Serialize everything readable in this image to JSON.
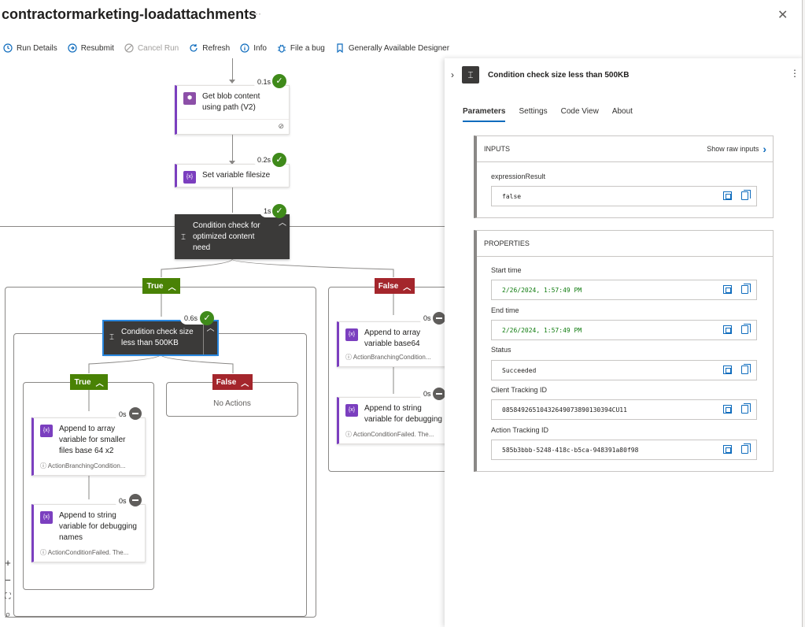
{
  "header": {
    "title": "contractormarketing-loadattachments",
    "more": "···",
    "close": "✕"
  },
  "toolbar": {
    "run_details": "Run Details",
    "resubmit": "Resubmit",
    "cancel_run": "Cancel Run",
    "refresh": "Refresh",
    "info": "Info",
    "file_bug": "File a bug",
    "designer": "Generally Available Designer"
  },
  "flow": {
    "get_blob": {
      "title": "Get blob content using path (V2)",
      "time": "0.1s"
    },
    "set_var": {
      "title": "Set variable filesize",
      "time": "0.2s"
    },
    "cond_optimized": {
      "title": "Condition check for optimized content need",
      "time": "1s"
    },
    "true_label": "True",
    "false_label": "False",
    "cond_size": {
      "title": "Condition check size less than 500KB",
      "time": "0.6s"
    },
    "append_base64": {
      "title": "Append to array variable base64",
      "sub": "ActionBranchingCondition...",
      "time": "0s"
    },
    "append_debug_right": {
      "title": "Append to string variable for debugging",
      "sub": "ActionConditionFailed. The...",
      "time": "0s"
    },
    "inner_true_label": "True",
    "inner_false_label": "False",
    "no_actions": "No Actions",
    "append_smaller": {
      "title": "Append to array variable for smaller files base 64 x2",
      "sub": "ActionBranchingCondition...",
      "time": "0s"
    },
    "append_debug_left": {
      "title": "Append to string variable for debugging names",
      "sub": "ActionConditionFailed. The...",
      "time": "0s"
    }
  },
  "zoom": {
    "in": "+",
    "out": "−",
    "fit": "⛶",
    "search": "⌕"
  },
  "panel": {
    "title": "Condition check size less than 500KB",
    "tabs": [
      "Parameters",
      "Settings",
      "Code View",
      "About"
    ],
    "inputs": {
      "heading": "INPUTS",
      "show_raw": "Show raw inputs",
      "label": "expressionResult",
      "value": "false"
    },
    "properties": {
      "heading": "PROPERTIES",
      "start_label": "Start time",
      "start_value": "2/26/2024, 1:57:49 PM",
      "end_label": "End time",
      "end_value": "2/26/2024, 1:57:49 PM",
      "status_label": "Status",
      "status_value": "Succeeded",
      "client_label": "Client Tracking ID",
      "client_value": "08584926510432649073890130394CU11",
      "action_label": "Action Tracking ID",
      "action_value": "585b3bbb-5248-418c-b5ca-948391a80f98"
    }
  },
  "colors": {
    "accent": "#0f6cbd",
    "true": "#498205",
    "false": "#a4262c",
    "success": "#3f8a1a",
    "purple": "#7b3fbf"
  }
}
